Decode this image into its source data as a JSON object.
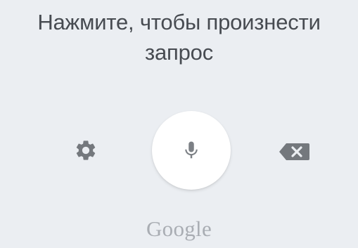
{
  "voice_input": {
    "prompt_line_1": "Нажмите, чтобы произнести",
    "prompt_line_2": "запрос",
    "brand": "Google",
    "icons": {
      "settings": "gear-icon",
      "microphone": "microphone-icon",
      "backspace": "backspace-icon"
    },
    "colors": {
      "background": "#ebeef2",
      "prompt_text": "#474b51",
      "icon": "#74787d",
      "brand_text": "#a9adb3",
      "mic_button": "#ffffff"
    }
  }
}
